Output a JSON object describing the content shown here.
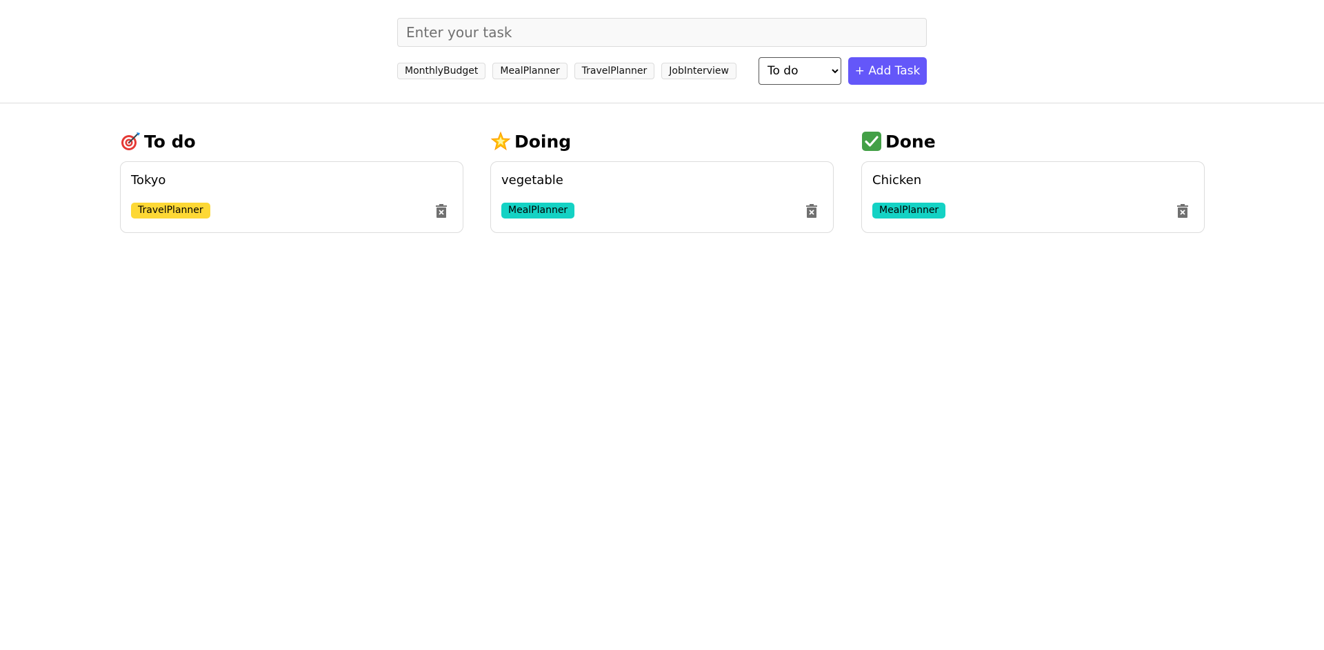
{
  "form": {
    "task_placeholder": "Enter your task",
    "task_value": "",
    "tags": [
      "MonthlyBudget",
      "MealPlanner",
      "TravelPlanner",
      "JobInterview"
    ],
    "status_selected": "To do",
    "status_options": [
      "To do",
      "Doing",
      "Done"
    ],
    "add_label": "+ Add Task",
    "accent_color": "#6457f9"
  },
  "columns": [
    {
      "title": "To do",
      "icon": "dart-target-icon",
      "tasks": [
        {
          "title": "Tokyo",
          "tag": "TravelPlanner",
          "tag_color": "#fdd835"
        }
      ]
    },
    {
      "title": "Doing",
      "icon": "glowing-star-icon",
      "tasks": [
        {
          "title": "vegetable",
          "tag": "MealPlanner",
          "tag_color": "#14d2c4"
        }
      ]
    },
    {
      "title": "Done",
      "icon": "check-mark-icon",
      "tasks": [
        {
          "title": "Chicken",
          "tag": "MealPlanner",
          "tag_color": "#14d2c4"
        }
      ]
    }
  ]
}
